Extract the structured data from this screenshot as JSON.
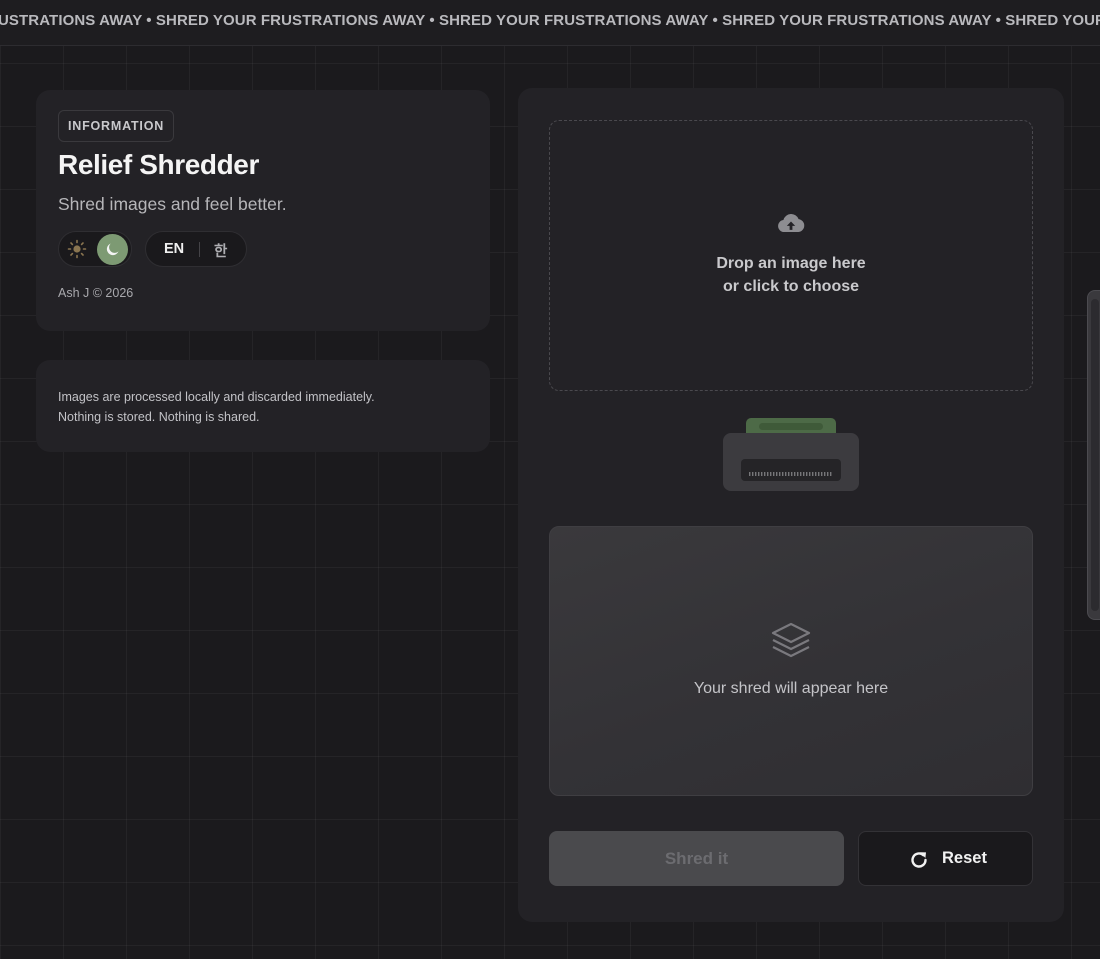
{
  "marquee": {
    "text": "USTRATIONS AWAY • SHRED YOUR FRUSTRATIONS AWAY • SHRED YOUR FRUSTRATIONS AWAY • SHRED YOUR FRUSTRATIONS AWAY • SHRED YOUR FRUSTRATIONS AWAY"
  },
  "info": {
    "badge": "INFORMATION",
    "title": "Relief Shredder",
    "subtitle": "Shred images and feel better.",
    "theme": {
      "selected": "dark",
      "icons": [
        "sun-icon",
        "moon-icon"
      ]
    },
    "language": {
      "en": "EN",
      "ko": "한",
      "selected": "EN"
    },
    "copyright": "Ash J © 2026"
  },
  "privacy": {
    "line1": "Images are processed locally and discarded immediately.",
    "line2": "Nothing is stored. Nothing is shared."
  },
  "dropzone": {
    "icon": "cloud-upload-icon",
    "line1": "Drop an image here",
    "line2": "or click to choose"
  },
  "output": {
    "icon": "layers-icon",
    "placeholder": "Your shred will appear here"
  },
  "actions": {
    "shred_label": "Shred it",
    "shred_enabled": false,
    "reset_label": "Reset",
    "reset_icon": "refresh-icon"
  },
  "colors": {
    "accent": "#7d9a73",
    "background": "#1b1a1d",
    "card": "#232226"
  }
}
